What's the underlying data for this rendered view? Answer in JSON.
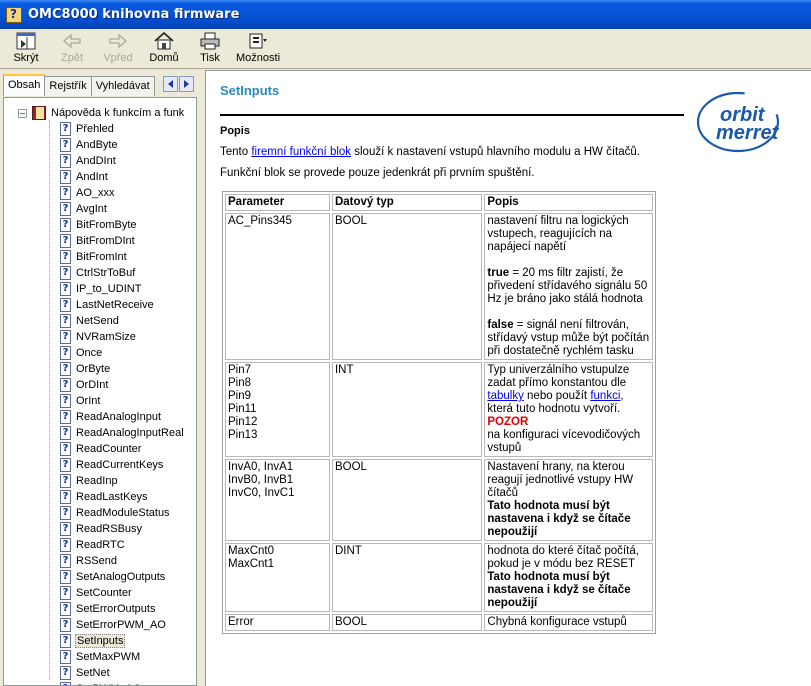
{
  "window": {
    "title": "OMC8000 knihovna firmware"
  },
  "toolbar": {
    "hide": "Skrýt",
    "back": "Zpět",
    "forward": "Vpřed",
    "home": "Domů",
    "print": "Tisk",
    "options": "Možnosti"
  },
  "tabs": [
    "Obsah",
    "Rejstřík",
    "Vyhledávat"
  ],
  "tree": {
    "root": "Nápověda k funkcím a funk",
    "items": [
      "Přehled",
      "AndByte",
      "AndDInt",
      "AndInt",
      "AO_xxx",
      "AvgInt",
      "BitFromByte",
      "BitFromDInt",
      "BitFromInt",
      "CtrlStrToBuf",
      "IP_to_UDINT",
      "LastNetReceive",
      "NetSend",
      "NVRamSize",
      "Once",
      "OrByte",
      "OrDInt",
      "OrInt",
      "ReadAnalogInput",
      "ReadAnalogInputReal",
      "ReadCounter",
      "ReadCurrentKeys",
      "ReadInp",
      "ReadLastKeys",
      "ReadModuleStatus",
      "ReadRSBusy",
      "ReadRTC",
      "RSSend",
      "SetAnalogOutputs",
      "SetCounter",
      "SetErrorOutputs",
      "SetErrorPWM_AO",
      "SetInputs",
      "SetMaxPWM",
      "SetNet",
      "SetPWM_AO"
    ],
    "selected_index": 32
  },
  "content": {
    "title": "SetInputs",
    "section": "Popis",
    "para1_pre": "Tento ",
    "para1_link": "firemní funkční blok",
    "para1_post": " slouží k nastavení vstupů hlavního modulu a HW čítačů.",
    "para2": "Funkční blok se provede pouze jedenkrát při prvním spuštění.",
    "logo_line1": "orbit",
    "logo_line2": "merret"
  },
  "table": {
    "headers": [
      "Parameter",
      "Datový typ",
      "Popis"
    ],
    "r1": {
      "param": "AC_Pins345",
      "type": "BOOL",
      "d1": "nastavení filtru na logických vstupech, reagujících na napájecí napětí",
      "d2_b": "true",
      "d2": " = 20 ms filtr zajistí, že přivedení střídavého signálu 50 Hz je bráno jako stálá hodnota",
      "d3_b": "false",
      "d3": " = signál není filtrován, střídavý vstup může být počítán při dostatečně rychlém tasku"
    },
    "r2": {
      "p1": "Pin7",
      "p2": "Pin8",
      "p3": "Pin9",
      "p4": "Pin11",
      "p5": "Pin12",
      "p6": "Pin13",
      "type": "INT",
      "d1": "Typ univerzálního vstupulze zadat přímo konstantou dle ",
      "link1": "tabulky",
      "d2": " nebo použít ",
      "link2": "funkci",
      "d3": ", která tuto hodnotu vytvoří.",
      "warn": "POZOR",
      "d4": "na konfiguraci vícevodičových vstupů"
    },
    "r3": {
      "p1": "InvA0, InvA1",
      "p2": "InvB0, InvB1",
      "p3": "InvC0, InvC1",
      "type": "BOOL",
      "d1": "Nastavení hrany, na kterou reagují jednotlivé vstupy HW čítačů",
      "d2": "Tato hodnota musí být nastavena i když se čítače nepoužijí"
    },
    "r4": {
      "p1": "MaxCnt0",
      "p2": "MaxCnt1",
      "type": "DINT",
      "d1": "hodnota do které čítač počítá, pokud je v módu bez RESET",
      "d2": "Tato hodnota musí být nastavena i když se čítače nepoužijí"
    },
    "r5": {
      "param": "Error",
      "type": "BOOL",
      "d1": "Chybná konfigurace vstupů"
    }
  },
  "colors": {
    "title_bar": "#0554d6",
    "page_title": "#2a8ab8",
    "logo": "#1a5aa8",
    "warning": "#e00000",
    "link": "#0000ee"
  }
}
